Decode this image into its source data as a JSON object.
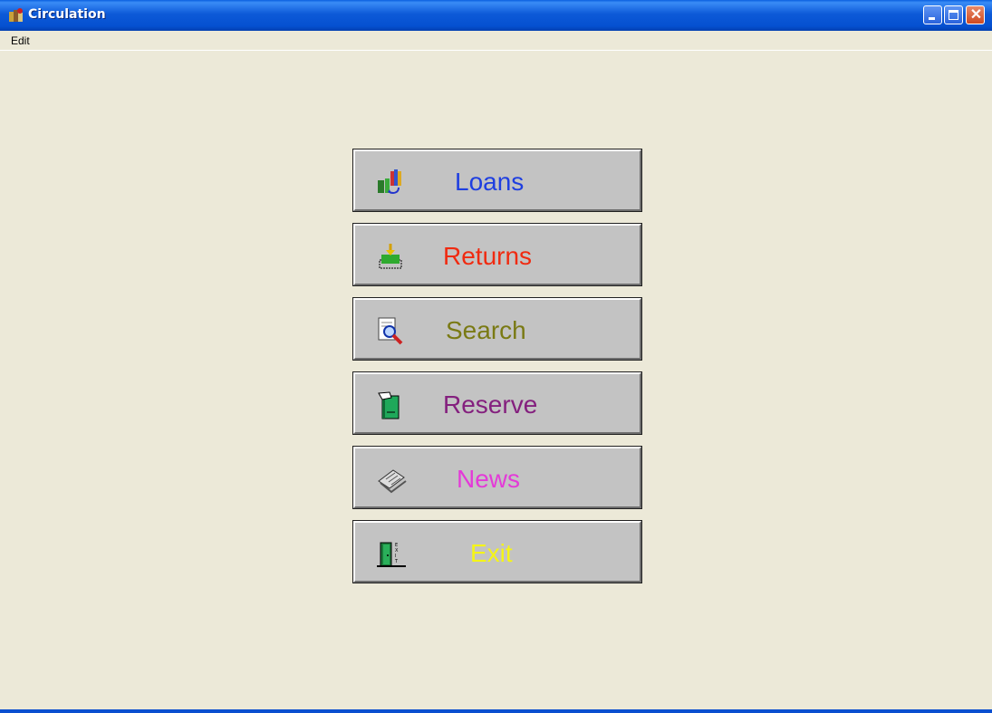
{
  "window": {
    "title": "Circulation"
  },
  "menu": {
    "edit": "Edit"
  },
  "buttons": [
    {
      "label": "Loans",
      "color": "#1f3fe0",
      "icon": "books-icon"
    },
    {
      "label": "Returns",
      "color": "#f02a10",
      "icon": "return-tray-icon"
    },
    {
      "label": "Search",
      "color": "#7a7a14",
      "icon": "search-document-icon"
    },
    {
      "label": "Reserve",
      "color": "#84207e",
      "icon": "reserve-book-icon"
    },
    {
      "label": "News",
      "color": "#e43ad8",
      "icon": "newspaper-icon"
    },
    {
      "label": "Exit",
      "color": "#f5f516",
      "icon": "exit-door-icon"
    }
  ]
}
